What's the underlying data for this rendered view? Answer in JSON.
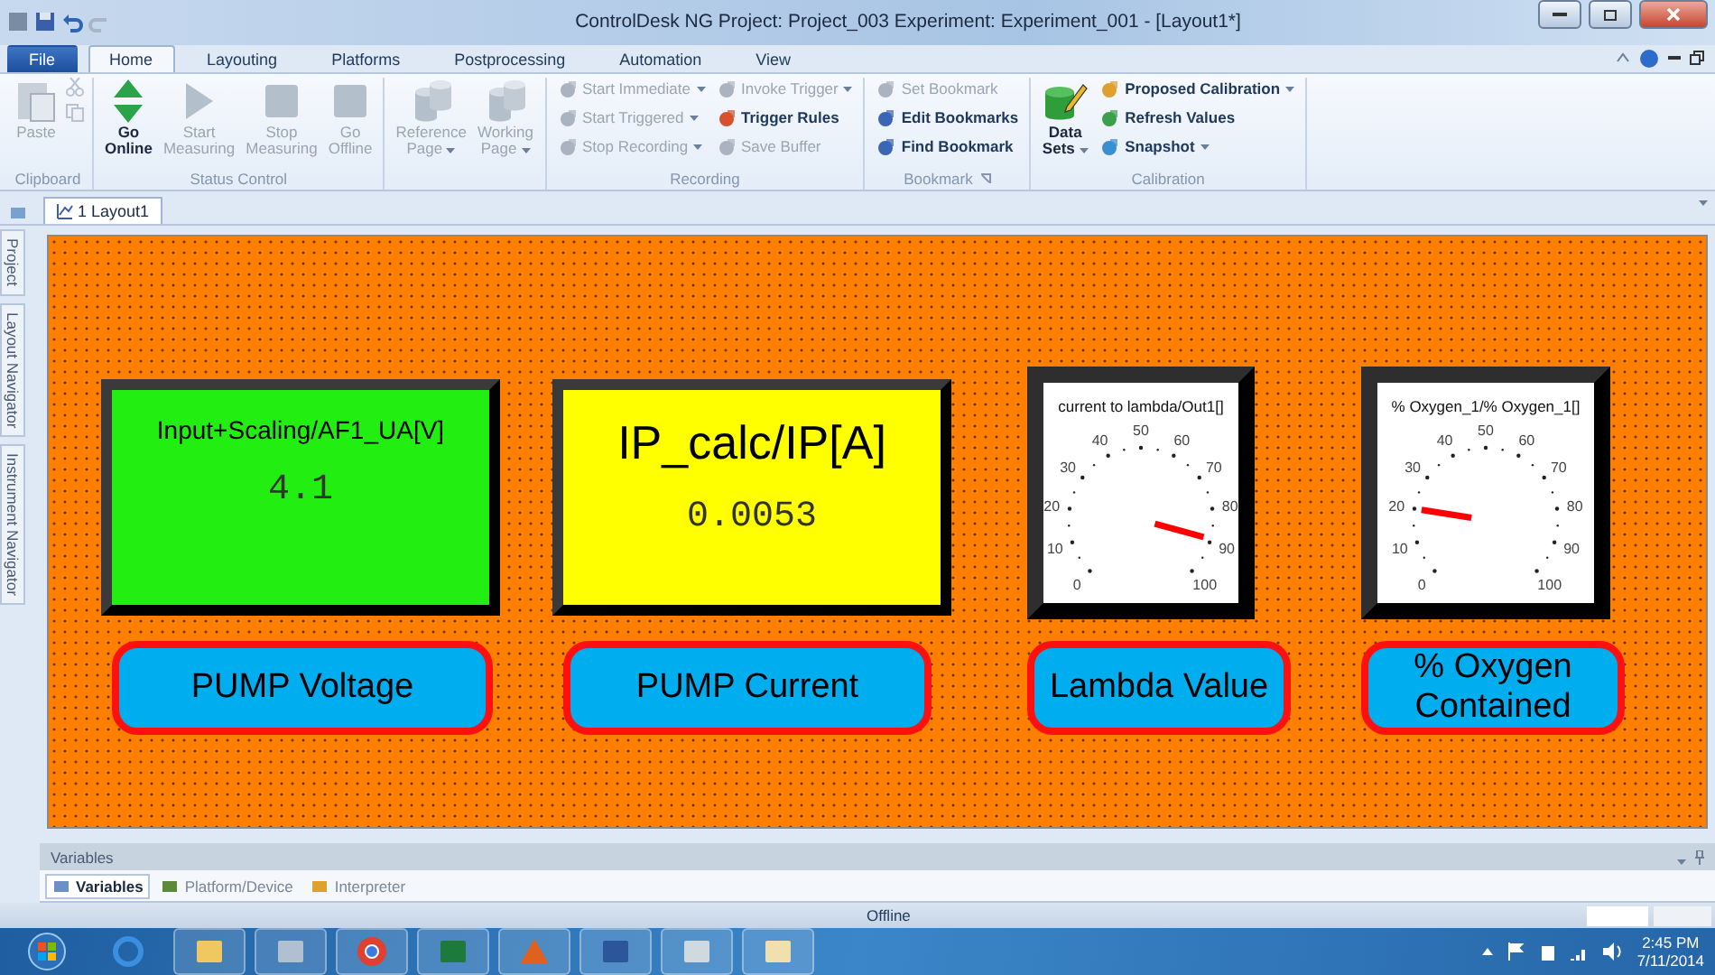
{
  "window": {
    "title": "ControlDesk NG  Project: Project_003  Experiment: Experiment_001 - [Layout1*]"
  },
  "ribbon_tabs": [
    {
      "label": "File",
      "selected": false,
      "kind": "file"
    },
    {
      "label": "Home",
      "selected": true,
      "kind": "tab"
    },
    {
      "label": "Layouting",
      "selected": false,
      "kind": "tab"
    },
    {
      "label": "Platforms",
      "selected": false,
      "kind": "tab"
    },
    {
      "label": "Postprocessing",
      "selected": false,
      "kind": "tab"
    },
    {
      "label": "Automation",
      "selected": false,
      "kind": "tab"
    },
    {
      "label": "View",
      "selected": false,
      "kind": "tab"
    }
  ],
  "ribbon_groups": [
    {
      "label": "Clipboard",
      "items": [
        {
          "kind": "large",
          "lines": [
            "Paste"
          ],
          "disabled": true,
          "dropdown": false
        },
        {
          "kind": "icons",
          "disabled": true
        }
      ]
    },
    {
      "label": "Status Control",
      "items": [
        {
          "kind": "large",
          "lines": [
            "Go",
            "Online"
          ],
          "disabled": false,
          "dropdown": false
        },
        {
          "kind": "large",
          "lines": [
            "Start",
            "Measuring"
          ],
          "disabled": true,
          "dropdown": false
        },
        {
          "kind": "large",
          "lines": [
            "Stop",
            "Measuring"
          ],
          "disabled": true,
          "dropdown": false
        },
        {
          "kind": "large",
          "lines": [
            "Go",
            "Offline"
          ],
          "disabled": true,
          "dropdown": false
        }
      ]
    },
    {
      "items": [
        {
          "kind": "large",
          "lines": [
            "Reference",
            "Page"
          ],
          "disabled": true,
          "dropdown": true
        },
        {
          "kind": "large",
          "lines": [
            "Working",
            "Page"
          ],
          "disabled": true,
          "dropdown": true
        }
      ]
    },
    {
      "label": "Recording",
      "items": [
        {
          "kind": "small",
          "label": "Start Immediate",
          "disabled": true,
          "dropdown": true
        },
        {
          "kind": "small",
          "label": "Start Triggered",
          "disabled": true,
          "dropdown": true
        },
        {
          "kind": "small",
          "label": "Stop Recording",
          "disabled": true,
          "dropdown": true
        },
        {
          "kind": "small",
          "label": "Invoke Trigger",
          "disabled": true,
          "dropdown": true
        },
        {
          "kind": "small",
          "label": "Trigger Rules",
          "disabled": false,
          "dropdown": false
        },
        {
          "kind": "small",
          "label": "Save Buffer",
          "disabled": true,
          "dropdown": false
        }
      ]
    },
    {
      "label": "Bookmark",
      "launcher": true,
      "items": [
        {
          "kind": "small",
          "label": "Set Bookmark",
          "disabled": true,
          "dropdown": false
        },
        {
          "kind": "small",
          "label": "Edit Bookmarks",
          "disabled": false,
          "dropdown": false
        },
        {
          "kind": "small",
          "label": "Find Bookmark",
          "disabled": false,
          "dropdown": false
        }
      ]
    },
    {
      "label": "Calibration",
      "items": [
        {
          "kind": "large",
          "lines": [
            "Data",
            "Sets"
          ],
          "disabled": false,
          "dropdown": true
        },
        {
          "kind": "small",
          "label": "Proposed Calibration",
          "disabled": false,
          "dropdown": true
        },
        {
          "kind": "small",
          "label": "Refresh Values",
          "disabled": false,
          "dropdown": false
        },
        {
          "kind": "small",
          "label": "Snapshot",
          "disabled": false,
          "dropdown": true
        }
      ]
    }
  ],
  "side_tabs": [
    "Project",
    "Layout Navigator",
    "Instrument Navigator"
  ],
  "document_tabs": [
    {
      "label": "1 Layout1",
      "selected": true
    }
  ],
  "layout": {
    "instruments": [
      {
        "kind": "display",
        "title": "Input+Scaling/AF1_UA[V]",
        "value": "4.1",
        "color": "#22ee11"
      },
      {
        "kind": "display",
        "title": "IP_calc/IP[A]",
        "value": "0.0053",
        "color": "#ffff00"
      },
      {
        "kind": "gauge",
        "title": "current to lambda/Out1[]",
        "ticks": [
          "0",
          "10",
          "20",
          "30",
          "40",
          "50",
          "60",
          "70",
          "80",
          "90",
          "100"
        ]
      },
      {
        "kind": "gauge",
        "title": "% Oxygen_1/% Oxygen_1[]",
        "ticks": [
          "0",
          "10",
          "20",
          "30",
          "40",
          "50",
          "60",
          "70",
          "80",
          "90",
          "100"
        ]
      }
    ],
    "buttons": [
      "PUMP Voltage",
      "PUMP Current",
      "Lambda Value",
      "% Oxygen Contained"
    ]
  },
  "variables_panel": {
    "title": "Variables",
    "tabs": [
      {
        "label": "Variables",
        "selected": true
      },
      {
        "label": "Platform/Device",
        "selected": false
      },
      {
        "label": "Interpreter",
        "selected": false
      }
    ]
  },
  "status_bar": {
    "text": "Offline"
  },
  "taskbar": {
    "time": "2:45 PM",
    "date": "7/11/2014"
  }
}
